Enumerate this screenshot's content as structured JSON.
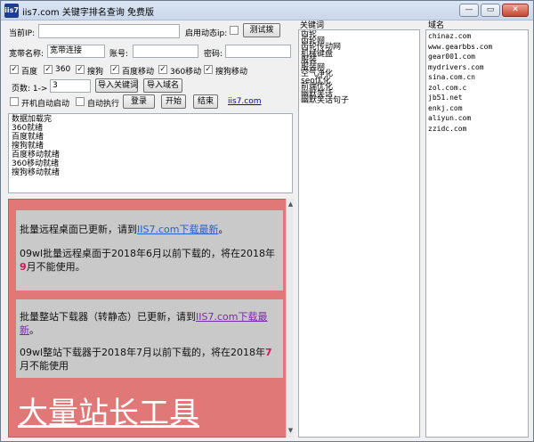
{
  "window": {
    "title": "iis7.com 关键字排名查询 免费版",
    "icon_text": "iis7",
    "controls": [
      "—",
      "▭",
      "✕"
    ]
  },
  "form": {
    "current_ip_label": "当前IP:",
    "current_ip_value": "",
    "dynamic_ip_label": "启用动态ip:",
    "test_dialup_label": "测试拨",
    "broadband_label": "宽带名称:",
    "broadband_value": "宽带连接",
    "account_label": "账号:",
    "account_value": "",
    "password_label": "密码:",
    "password_value": "",
    "engines": [
      {
        "label": "百度",
        "checked": true
      },
      {
        "label": "360",
        "checked": true
      },
      {
        "label": "搜狗",
        "checked": true
      },
      {
        "label": "百度移动",
        "checked": true
      },
      {
        "label": "360移动",
        "checked": true
      },
      {
        "label": "搜狗移动",
        "checked": true
      }
    ],
    "pages_label": "页数: 1->",
    "pages_value": "3",
    "import_keywords_label": "导入关键词",
    "import_domains_label": "导入域名",
    "autostart_label": "开机自动启动",
    "autorun_label": "自动执行",
    "login_label": "登录",
    "start_label": "开始",
    "stop_label": "结束",
    "site_link": "iis7.com"
  },
  "log": [
    "数据加载完",
    "360就绪",
    "百度就绪",
    "搜狗就绪",
    "百度移动就绪",
    "360移动就绪",
    "搜狗移动就绪"
  ],
  "ad": {
    "p1_pre": "批量远程桌面已更新，请到",
    "p1_link": "IIS7.com下载最新",
    "p1_post": "。",
    "p1_note_a": "09wl批量远程桌面于2018年6月以前下载的，将在2018年",
    "p1_note_hl": "9",
    "p1_note_b": "月不能使用。",
    "p2_pre": "批量整站下载器（转静态）已更新，请到",
    "p2_link": "IIS7.com下载最新",
    "p2_post": "。",
    "p2_note_a": "09wl整站下载器于2018年7月以前下载的，将在2018年",
    "p2_note_hl": "7",
    "p2_note_b": "月不能使用",
    "big_text": "大量站长工具"
  },
  "keywords": {
    "header": "关键词",
    "items": [
      "齿轮",
      "齿轮网",
      "齿轮传动网",
      "机械键盘",
      "服装",
      "服装网",
      "空气净化",
      "seo优化",
      "前端优化",
      "幽默笑话",
      "幽默笑话句子"
    ]
  },
  "domains": {
    "header": "域名",
    "items": [
      "chinaz.com",
      "www.gearbbs.com",
      "gear001.com",
      "mydrivers.com",
      "sina.com.cn",
      "zol.com.c",
      "jb51.net",
      "enkj.com",
      "aliyun.com",
      "zzidc.com"
    ]
  }
}
